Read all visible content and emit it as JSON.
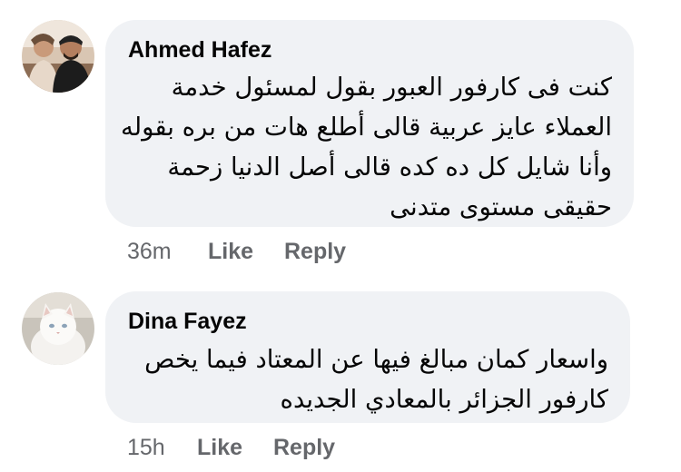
{
  "comments": [
    {
      "author": "Ahmed Hafez",
      "lines": [
        "كنت فى كارفور العبور بقول لمسئول خدمة",
        "العملاء عايز عربية قالى أطلع هات من بره بقوله",
        "وأنا شايل كل ده كده قالى أصل الدنيا زحمة",
        "حقيقى مستوى متدنى"
      ],
      "time": "36m",
      "like_label": "Like",
      "reply_label": "Reply",
      "avatar_icon": "profile-photo-two-people"
    },
    {
      "author": "Dina Fayez",
      "lines": [
        "واسعار كمان مبالغ فيها عن المعتاد فيما يخص",
        "كارفور الجزائر بالمعادي الجديده"
      ],
      "time": "15h",
      "like_label": "Like",
      "reply_label": "Reply",
      "avatar_icon": "profile-photo-white-cat"
    }
  ],
  "colors": {
    "bubble": "#f0f2f5",
    "text": "#050505",
    "meta": "#65676b"
  }
}
